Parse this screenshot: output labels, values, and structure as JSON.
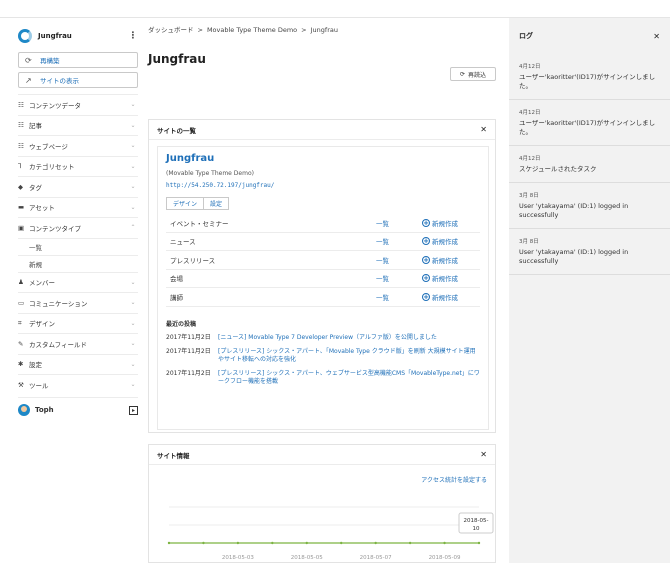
{
  "sidebar": {
    "site_name": "Jungfrau",
    "rebuild_label": "再構築",
    "view_site_label": "サイトの表示",
    "nav_items": [
      {
        "label": "コンテンツデータ",
        "icon": "list-icon"
      },
      {
        "label": "記事",
        "icon": "list-icon"
      },
      {
        "label": "ウェブページ",
        "icon": "list-icon"
      },
      {
        "label": "カテゴリセット",
        "icon": "category-icon"
      },
      {
        "label": "タグ",
        "icon": "tag-icon"
      },
      {
        "label": "アセット",
        "icon": "asset-icon"
      },
      {
        "label": "コンテンツタイプ",
        "icon": "content-type-icon"
      }
    ],
    "sub_items": [
      "一覧",
      "新規"
    ],
    "nav_items_2": [
      {
        "label": "メンバー",
        "icon": "user-icon"
      },
      {
        "label": "コミュニケーション",
        "icon": "comment-icon"
      },
      {
        "label": "デザイン",
        "icon": "design-icon"
      },
      {
        "label": "カスタムフィールド",
        "icon": "field-icon"
      },
      {
        "label": "設定",
        "icon": "gear-icon"
      },
      {
        "label": "ツール",
        "icon": "wrench-icon"
      }
    ],
    "user": "Toph"
  },
  "breadcrumb": [
    "ダッシュボード",
    "Movable Type Theme Demo",
    "Jungfrau"
  ],
  "page_title": "Jungfrau",
  "reload_label": "再読込",
  "site_list": {
    "title": "サイトの一覧",
    "blog_name": "Jungfrau",
    "blog_desc": "(Movable Type Theme Demo)",
    "blog_url": "http://54.250.72.197/jungfrau/",
    "tabs": [
      "デザイン",
      "設定"
    ],
    "rows": [
      {
        "name": "イベント・セミナー",
        "list": "一覧",
        "new": "新規作成"
      },
      {
        "name": "ニュース",
        "list": "一覧",
        "new": "新規作成"
      },
      {
        "name": "プレスリリース",
        "list": "一覧",
        "new": "新規作成"
      },
      {
        "name": "会場",
        "list": "一覧",
        "new": "新規作成"
      },
      {
        "name": "講師",
        "list": "一覧",
        "new": "新規作成"
      }
    ],
    "recent_title": "最近の投稿",
    "posts": [
      {
        "date": "2017年11月2日",
        "title": "[ニュース] Movable Type 7 Developer Preview（アルファ版）を公開しました"
      },
      {
        "date": "2017年11月2日",
        "title": "[プレスリリース] シックス・アパート、「Movable Type クラウド版」を刷新 大規模サイト運用やサイト移転への対応を強化"
      },
      {
        "date": "2017年11月2日",
        "title": "[プレスリリース] シックス・アパート、ウェブサービス型高機能CMS「MovableType.net」にワークフロー機能を搭載"
      }
    ]
  },
  "site_info": {
    "title": "サイト情報",
    "stats_link": "アクセス統計を設定する",
    "tooltip": "2018-05-10",
    "chart_data": {
      "type": "line",
      "x": [
        "2018-05-01",
        "2018-05-02",
        "2018-05-03",
        "2018-05-04",
        "2018-05-05",
        "2018-05-06",
        "2018-05-07",
        "2018-05-08",
        "2018-05-09",
        "2018-05-10"
      ],
      "tick_labels": [
        "2018-05-03",
        "2018-05-05",
        "2018-05-07",
        "2018-05-09"
      ],
      "series": [
        {
          "values": [
            0,
            0,
            0,
            0,
            0,
            0,
            0,
            0,
            0,
            0
          ],
          "color": "#7cb342"
        }
      ]
    }
  },
  "log": {
    "title": "ログ",
    "entries": [
      {
        "date": "4月12日",
        "msg": "ユーザー'kaoritter'(ID17)がサインインしました。"
      },
      {
        "date": "4月12日",
        "msg": "ユーザー'kaoritter'(ID17)がサインインしました。"
      },
      {
        "date": "4月12日",
        "msg": "スケジュールされたタスク"
      },
      {
        "date": "3月 8日",
        "msg": "User 'ytakayama' (ID:1) logged in successfully"
      },
      {
        "date": "3月 8日",
        "msg": "User 'ytakayama' (ID:1) logged in successfully"
      }
    ]
  }
}
